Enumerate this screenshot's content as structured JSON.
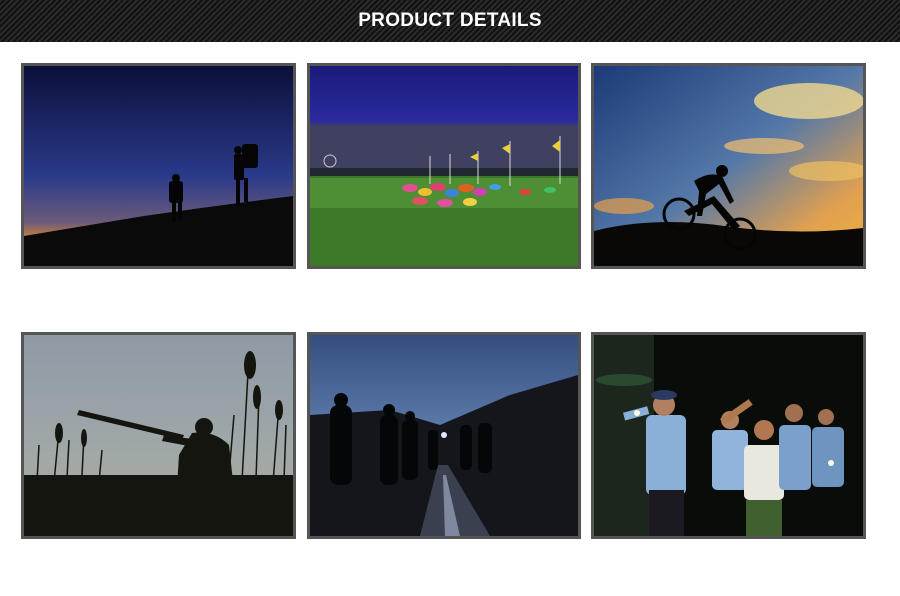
{
  "banner": {
    "title": "PRODUCT DETAILS"
  },
  "colors": {
    "banner_bg": "#1a1a1a",
    "frame_border": "#555555",
    "page_bg": "#ffffff"
  },
  "photos": [
    {
      "subject": "hikers-at-dusk"
    },
    {
      "subject": "tent-camp-at-night"
    },
    {
      "subject": "cyclist-at-sunset"
    },
    {
      "subject": "hunter-in-reeds"
    },
    {
      "subject": "people-walking-on-road-at-night"
    },
    {
      "subject": "police-officers-with-flashlights"
    }
  ]
}
